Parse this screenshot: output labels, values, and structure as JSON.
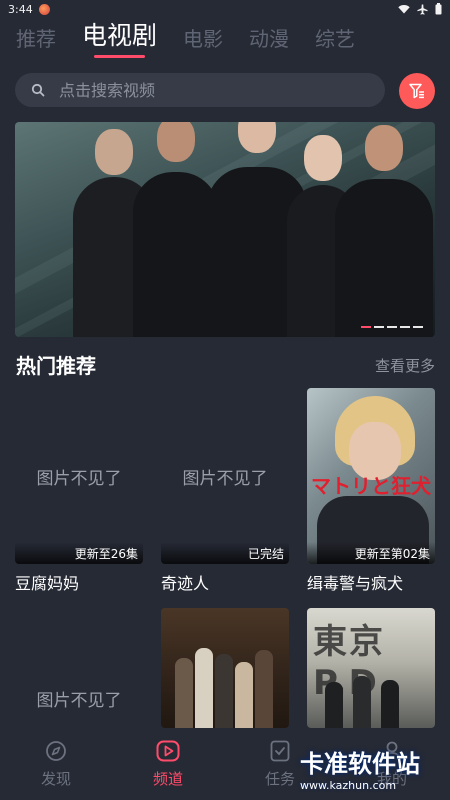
{
  "status_bar": {
    "time": "3:44"
  },
  "tabs": [
    {
      "label": "推荐"
    },
    {
      "label": "电视剧"
    },
    {
      "label": "电影"
    },
    {
      "label": "动漫"
    },
    {
      "label": "综艺"
    }
  ],
  "active_tab": "电视剧",
  "search": {
    "placeholder": "点击搜索视频",
    "value": ""
  },
  "banner": {
    "page_count": 5,
    "active_page": 1
  },
  "section": {
    "title": "热门推荐",
    "more": "查看更多"
  },
  "cards": [
    {
      "title": "豆腐妈妈",
      "badge": "更新至26集",
      "image_missing_text": "图片不见了"
    },
    {
      "title": "奇迹人",
      "badge": "已完结",
      "image_missing_text": "图片不见了"
    },
    {
      "title": "缉毒警与疯犬",
      "badge": "更新至第02集",
      "poster_text": "マトリと狂犬"
    },
    {
      "title": "",
      "badge": "",
      "image_missing_text": "图片不见了"
    },
    {
      "title": "",
      "badge": ""
    },
    {
      "title": "",
      "badge": "",
      "poster_text": "東京P.D."
    }
  ],
  "bottom_nav": [
    {
      "label": "发现",
      "icon": "compass-icon"
    },
    {
      "label": "频道",
      "icon": "play-icon"
    },
    {
      "label": "任务",
      "icon": "task-icon"
    },
    {
      "label": "我的",
      "icon": "user-icon"
    }
  ],
  "active_nav": "频道",
  "watermark": {
    "title": "卡准软件站",
    "url": "www.kazhun.com"
  },
  "colors": {
    "accent": "#ff4c6a",
    "filter_button": "#ff5a5a",
    "background": "#262a35"
  }
}
